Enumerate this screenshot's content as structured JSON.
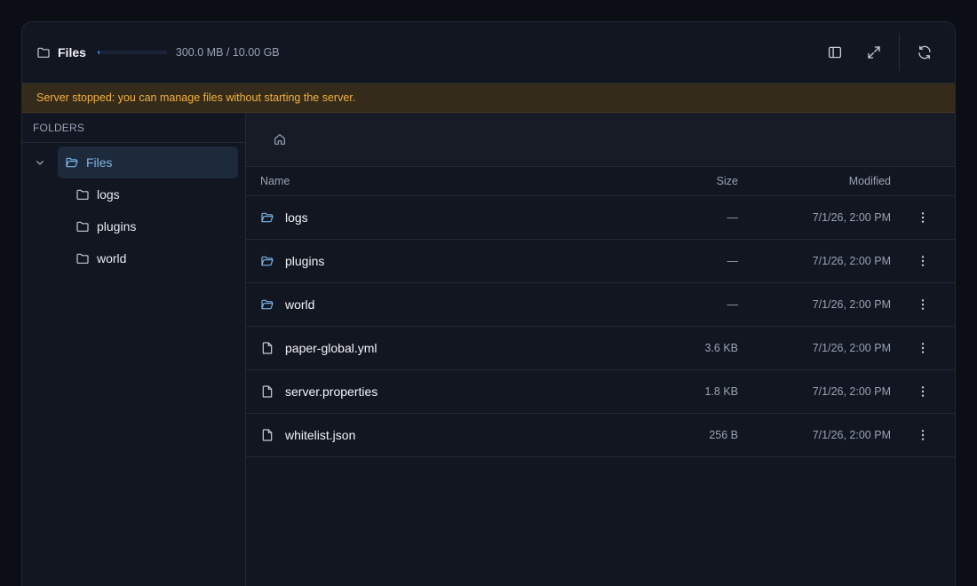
{
  "header": {
    "title": "Files",
    "usage_text": "300.0 MB / 10.00 GB",
    "usage_fraction": 0.03,
    "actions": [
      {
        "icon": "sidebar-toggle-icon"
      },
      {
        "icon": "expand-icon"
      },
      {
        "icon": "refresh-icon"
      }
    ]
  },
  "banner": {
    "text": "Server stopped: you can manage files without starting the server."
  },
  "sidebar": {
    "heading": "FOLDERS",
    "root": {
      "label": "Files",
      "icon": "folder-open-icon"
    },
    "children": [
      {
        "label": "logs",
        "icon": "folder-icon"
      },
      {
        "label": "plugins",
        "icon": "folder-icon"
      },
      {
        "label": "world",
        "icon": "folder-icon"
      }
    ]
  },
  "breadcrumb": {
    "icon": "home-icon"
  },
  "table": {
    "columns": {
      "name": "Name",
      "size": "Size",
      "modified": "Modified"
    },
    "rows": [
      {
        "name": "logs",
        "type": "folder",
        "size": "—",
        "modified": "7/1/26, 2:00 PM"
      },
      {
        "name": "plugins",
        "type": "folder",
        "size": "—",
        "modified": "7/1/26, 2:00 PM"
      },
      {
        "name": "world",
        "type": "folder",
        "size": "—",
        "modified": "7/1/26, 2:00 PM"
      },
      {
        "name": "paper-global.yml",
        "type": "file",
        "size": "3.6 KB",
        "modified": "7/1/26, 2:00 PM"
      },
      {
        "name": "server.properties",
        "type": "file",
        "size": "1.8 KB",
        "modified": "7/1/26, 2:00 PM"
      },
      {
        "name": "whitelist.json",
        "type": "file",
        "size": "256 B",
        "modified": "7/1/26, 2:00 PM"
      }
    ]
  },
  "colors": {
    "accent": "#7fb3e6",
    "warning_text": "#f3b13d",
    "warning_bg": "#352b1a",
    "background": "#121621"
  }
}
